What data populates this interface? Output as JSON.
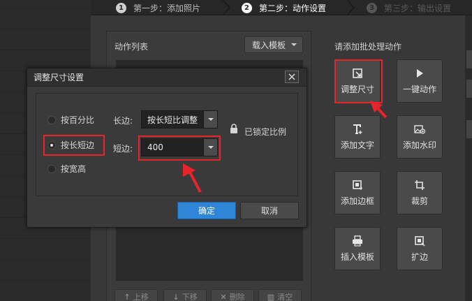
{
  "steps": [
    {
      "num": "1",
      "label": "第一步：添加照片"
    },
    {
      "num": "2",
      "label": "第二步：动作设置"
    },
    {
      "num": "3",
      "label": "第三步：输出设置"
    }
  ],
  "left_panel": {
    "title": "动作列表",
    "template_button": "载入模板",
    "bottom_buttons": [
      "上移",
      "下移",
      "删除",
      "清空"
    ]
  },
  "right_panel": {
    "title": "请添加批处理动作",
    "actions": [
      {
        "label": "调整尺寸",
        "icon": "resize-icon"
      },
      {
        "label": "一键动作",
        "icon": "play-icon"
      },
      {
        "label": "添加文字",
        "icon": "text-icon"
      },
      {
        "label": "添加水印",
        "icon": "watermark-icon"
      },
      {
        "label": "添加边框",
        "icon": "border-icon"
      },
      {
        "label": "裁剪",
        "icon": "crop-icon"
      },
      {
        "label": "插入模板",
        "icon": "template-icon"
      },
      {
        "label": "扩边",
        "icon": "expand-icon"
      }
    ]
  },
  "dialog": {
    "title": "调整尺寸设置",
    "radios": [
      {
        "label": "按百分比",
        "checked": false
      },
      {
        "label": "按长短边",
        "checked": true
      },
      {
        "label": "按宽高",
        "checked": false
      }
    ],
    "long_side_label": "长边:",
    "long_side_value": "按长短比调整",
    "short_side_label": "短边:",
    "short_side_value": "400",
    "lock_text": "已锁定比例",
    "ok": "确定",
    "cancel": "取消"
  },
  "colors": {
    "highlight": "#e8242a",
    "primary_button": "#2f86d8"
  }
}
